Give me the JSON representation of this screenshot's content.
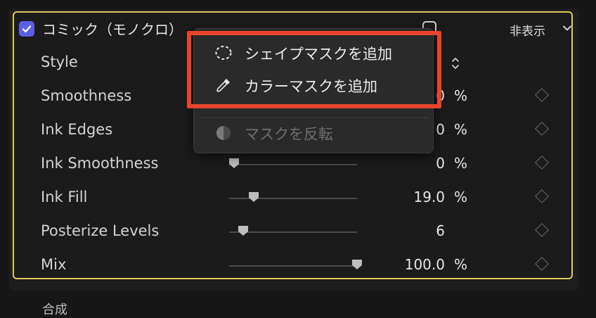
{
  "effect": {
    "enabled": true,
    "name": "コミック（モノクロ）",
    "visibility_label": "非表示"
  },
  "params": [
    {
      "label": "Style",
      "value": "",
      "unit": "",
      "control": "popup"
    },
    {
      "label": "Smoothness",
      "value": "0",
      "unit": "%",
      "control": "slider"
    },
    {
      "label": "Ink Edges",
      "value": "0",
      "unit": "%",
      "control": "slider"
    },
    {
      "label": "Ink Smoothness",
      "value": "0",
      "unit": "%",
      "control": "slider",
      "slider_fraction": 0.0
    },
    {
      "label": "Ink Fill",
      "value": "19.0",
      "unit": "%",
      "control": "slider",
      "slider_fraction": 0.19
    },
    {
      "label": "Posterize Levels",
      "value": "6",
      "unit": "",
      "control": "slider",
      "slider_fraction": 0.11
    },
    {
      "label": "Mix",
      "value": "100.0",
      "unit": "%",
      "control": "slider",
      "slider_fraction": 1.0
    }
  ],
  "context_menu": {
    "items": [
      {
        "label": "シェイプマスクを追加",
        "icon": "dashed-circle-icon",
        "enabled": true
      },
      {
        "label": "カラーマスクを追加",
        "icon": "eyedropper-icon",
        "enabled": true
      },
      {
        "label": "マスクを反転",
        "icon": "half-circle-icon",
        "enabled": false
      }
    ]
  },
  "next_section": {
    "label": "合成"
  },
  "colors": {
    "accent_border": "#e0c95a",
    "checkbox": "#5b5ee6",
    "highlight": "#e8452c"
  }
}
